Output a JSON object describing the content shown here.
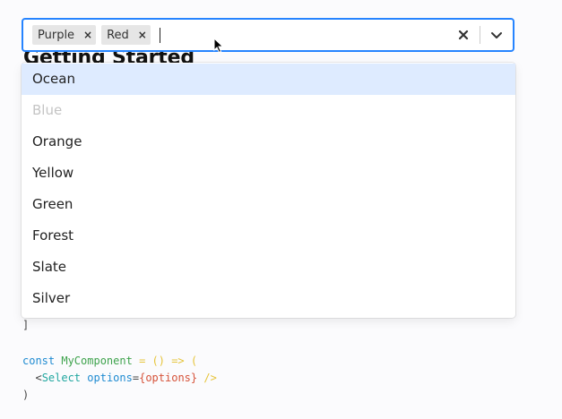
{
  "heading": "Getting Started",
  "select": {
    "selected": [
      {
        "label": "Purple",
        "remove": "×"
      },
      {
        "label": "Red",
        "remove": "×"
      }
    ],
    "clear_icon": "x-icon",
    "dropdown_icon": "chevron-down-icon",
    "accent_color": "#2684ff"
  },
  "menu": {
    "options": [
      {
        "label": "Ocean",
        "state": "focused"
      },
      {
        "label": "Blue",
        "state": "disabled"
      },
      {
        "label": "Orange",
        "state": "normal"
      },
      {
        "label": "Yellow",
        "state": "normal"
      },
      {
        "label": "Green",
        "state": "normal"
      },
      {
        "label": "Forest",
        "state": "normal"
      },
      {
        "label": "Slate",
        "state": "normal"
      },
      {
        "label": "Silver",
        "state": "normal"
      }
    ]
  },
  "code": {
    "bracket": "]",
    "line1": {
      "kw": "const",
      "name": "MyComponent",
      "op": "= () => ("
    },
    "line2": {
      "open": "<",
      "tag": "Select",
      "attr": "options",
      "eq": "=",
      "value": "{options}",
      "close": "/>"
    },
    "line3": ")"
  }
}
